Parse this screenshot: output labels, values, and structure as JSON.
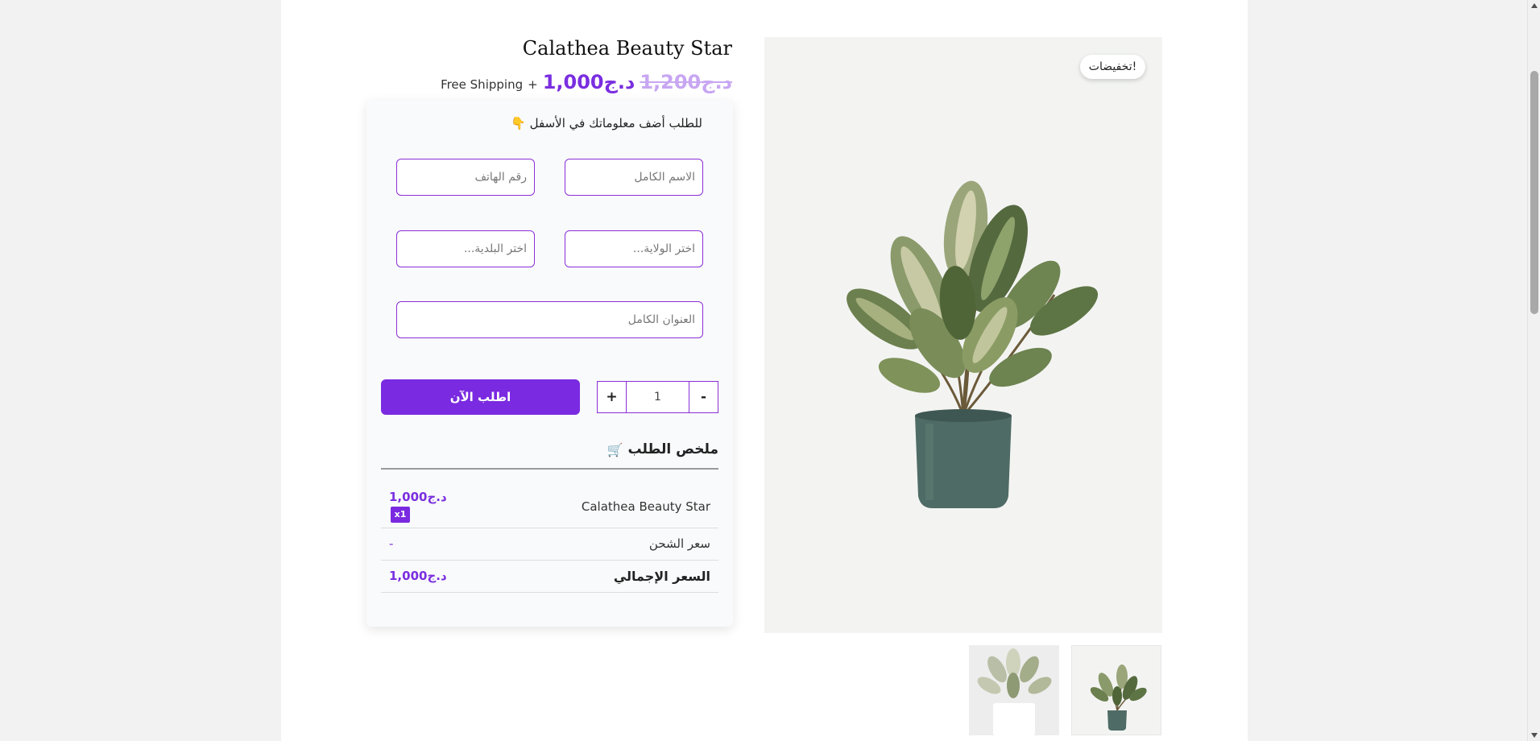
{
  "product": {
    "title": "Calathea Beauty Star",
    "old_price": "1,200د.ج",
    "price": "1,000د.ج",
    "plus": "+",
    "shipping": "Free Shipping",
    "sale_badge": "تخفيضات!"
  },
  "form": {
    "heading": "للطلب أضف معلوماتك في الأسفل 👇",
    "name_placeholder": "الاسم الكامل",
    "phone_placeholder": "رقم الهاتف",
    "state_placeholder": "اختر الولاية...",
    "city_placeholder": "اختر البلدية...",
    "address_placeholder": "العنوان الكامل",
    "quantity": "1",
    "minus_label": "-",
    "plus_label": "+",
    "order_button": "اطلب الآن"
  },
  "summary": {
    "title": "ملخص الطلب",
    "cart_icon": "🛒",
    "item_name": "Calathea Beauty Star",
    "item_price": "1,000د.ج",
    "item_qty": "x1",
    "shipping_label": "سعر الشحن",
    "shipping_value": "-",
    "total_label": "السعر الإجمالي",
    "total_value": "1,000د.ج"
  },
  "colors": {
    "accent": "#7a2ae0",
    "old_price": "#c8a6f2"
  }
}
